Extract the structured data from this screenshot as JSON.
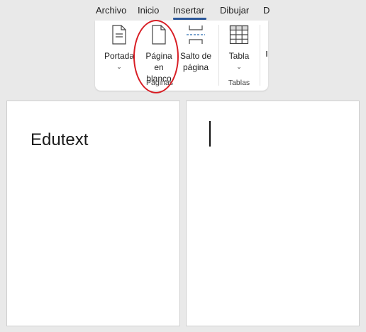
{
  "ribbon_tabs": [
    {
      "label": "Archivo"
    },
    {
      "label": "Inicio"
    },
    {
      "label": "Insertar"
    },
    {
      "label": "Dibujar"
    },
    {
      "label": "D"
    }
  ],
  "active_tab": "Insertar",
  "groups": {
    "paginas": {
      "label": "Páginas",
      "buttons": {
        "portada": {
          "label": "Portada",
          "icon": "cover-page-icon"
        },
        "pagina_blanco": {
          "line1": "Página",
          "line2": "en blanco",
          "icon": "blank-page-icon"
        },
        "salto_pagina": {
          "line1": "Salto de",
          "line2": "página",
          "icon": "page-break-icon"
        }
      }
    },
    "tablas": {
      "label": "Tablas",
      "buttons": {
        "tabla": {
          "label": "Tabla",
          "icon": "table-icon"
        }
      }
    }
  },
  "annotation_color": "#d81e25",
  "accent_color": "#2b579a",
  "document": {
    "page1_text": "Edutext",
    "page2_text": ""
  }
}
